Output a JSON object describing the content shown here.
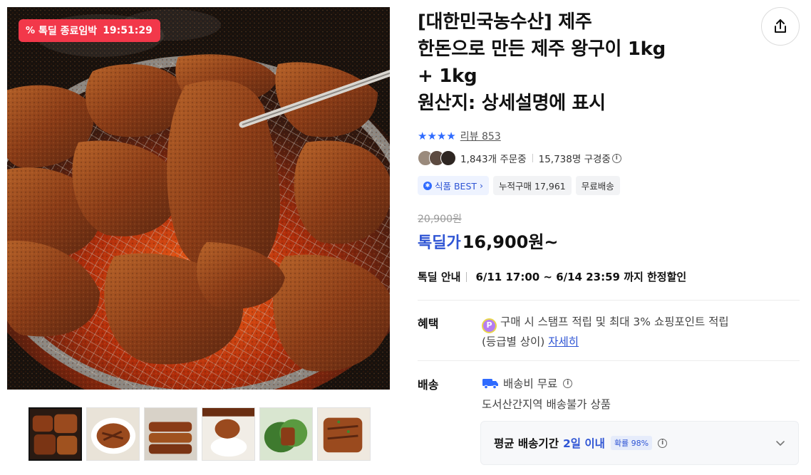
{
  "deal_badge": {
    "label": "톡딜 종료임박",
    "timer": "19:51:29",
    "icon": "percent-icon"
  },
  "product": {
    "title_lines": [
      "[대한민국농수산] 제주",
      "한돈으로 만든 제주 왕구이 1kg",
      "+ 1kg",
      "원산지: 상세설명에 표시"
    ]
  },
  "rating": {
    "stars": 4,
    "stars_text": "★★★★",
    "review_label": "리뷰 853"
  },
  "social": {
    "orders": "1,843개 주문중",
    "viewers": "15,738명 구경중"
  },
  "tags": {
    "best": "식품 BEST",
    "cumulative": "누적구매 17,961",
    "free_ship": "무료배송"
  },
  "price": {
    "original": "20,900원",
    "sale_label": "톡딜가",
    "sale_price": "16,900원~"
  },
  "deal_info": {
    "label": "톡딜 안내",
    "period": "6/11 17:00 ~ 6/14 23:59 까지 한정할인"
  },
  "benefit": {
    "label": "혜택",
    "badge": "P",
    "text1": "구매 시 스탬프 적립 및 최대 3% 쇼핑포인트 적립",
    "text2": "(등급별 상이)",
    "link": "자세히"
  },
  "shipping": {
    "label": "배송",
    "fee": "배송비 무료",
    "note": "도서산간지역 배송불가 상품",
    "avg_label": "평균 배송기간",
    "avg_value": "2일 이내",
    "prob": "확률 98%"
  },
  "colors": {
    "accent_blue": "#2f55d4",
    "deal_red": "#f2384a",
    "star_blue": "#2f6bff"
  },
  "thumbnails": [
    "thumb-1",
    "thumb-2",
    "thumb-3",
    "thumb-4",
    "thumb-5",
    "thumb-6"
  ]
}
